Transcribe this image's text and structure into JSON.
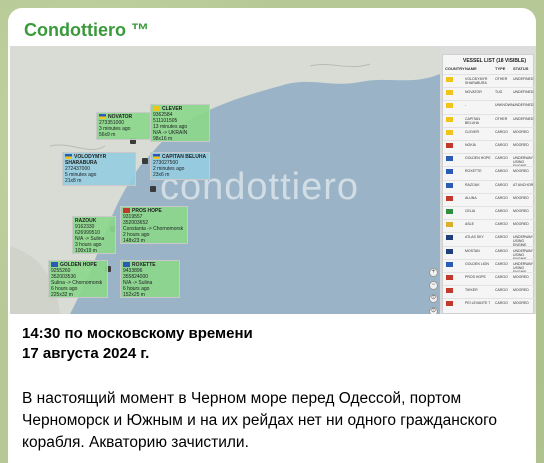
{
  "channel": {
    "name": "Condottiero ™"
  },
  "map": {
    "watermark": "condottiero",
    "vessel_labels": [
      {
        "name": "NOVATOR",
        "lines": [
          "273351000",
          "3 minutes ago",
          "56x9 m"
        ],
        "color": "green"
      },
      {
        "name": "CLEVER",
        "lines": [
          "9362584",
          "511101505",
          "13 minutes ago",
          "N/A -> UKRAIN",
          "98x16 m"
        ],
        "color": "green"
      },
      {
        "name": "VOLODYMYR SHARABURA",
        "lines": [
          "272437000",
          "5 minutes ago",
          "21x8 m"
        ],
        "color": "blue"
      },
      {
        "name": "CAPITAN BELUHA",
        "lines": [
          "273027500",
          "2 minutes ago",
          "23x6 m"
        ],
        "color": "blue"
      },
      {
        "name": "PROS HOPE",
        "lines": [
          "9319557",
          "352003652",
          "Constanta -> Chornomorsk",
          "2 hours ago",
          "148x23 m"
        ],
        "color": "green"
      },
      {
        "name": "RAZOUK",
        "lines": [
          "9162330",
          "626999510",
          "N/A -> Sulina",
          "3 hours ago",
          "100x19 m"
        ],
        "color": "green"
      },
      {
        "name": "GOLDEN HOPE",
        "lines": [
          "9255260",
          "352003536",
          "Sulina -> Chornomorsk",
          "6 hours ago",
          "225x32 m"
        ],
        "color": "green"
      },
      {
        "name": "ROXETTE",
        "lines": [
          "9433896",
          "355824000",
          "N/A -> Sulina",
          "6 hours ago",
          "152x25 m"
        ],
        "color": "green"
      }
    ],
    "zoom_buttons": [
      "+",
      "−",
      "⊙",
      "⊙"
    ]
  },
  "vessel_list": {
    "title": "VESSEL LIST (18 VISIBLE)",
    "headers": [
      "COUNTRY",
      "NAME",
      "TYPE",
      "STATUS"
    ],
    "rows": [
      {
        "name": "VOLODYMYR SHARABURA",
        "type": "OTHER",
        "status": "UNDEFINED",
        "flag": "#f0c419"
      },
      {
        "name": "NOVATOR",
        "type": "TUG",
        "status": "UNDEFINED",
        "flag": "#f0c419"
      },
      {
        "name": "-",
        "type": "UNKNOWN",
        "status": "UNDEFINED",
        "flag": "#f0c419"
      },
      {
        "name": "CAPITAN BELUHA",
        "type": "OTHER",
        "status": "UNDEFINED",
        "flag": "#f0c419"
      },
      {
        "name": "CLEVER",
        "type": "CARGO",
        "status": "MOORED",
        "flag": "#f0c419"
      },
      {
        "name": "NOKIA",
        "type": "CARGO",
        "status": "MOORED",
        "flag": "#c0392b"
      },
      {
        "name": "GOLDEN HOPE",
        "type": "CARGO",
        "status": "UNDERWAY USING ENGINE",
        "flag": "#2b5bb5"
      },
      {
        "name": "ROXETTE",
        "type": "CARGO",
        "status": "MOORED",
        "flag": "#2b5bb5"
      },
      {
        "name": "RAZOUK",
        "type": "CARGO",
        "status": "AT ANCHOR",
        "flag": "#2b5bb5"
      },
      {
        "name": "ALUNA",
        "type": "CARGO",
        "status": "MOORED",
        "flag": "#c0392b"
      },
      {
        "name": "CELIA",
        "type": "CARGO",
        "status": "MOORED",
        "flag": "#2f8f3f"
      },
      {
        "name": "ASLE",
        "type": "CARGO",
        "status": "MOORED",
        "flag": "#d8b02c"
      },
      {
        "name": "ATLAS SKY",
        "type": "CARGO",
        "status": "UNDERWAY USING ENGINE",
        "flag": "#1f3f7a"
      },
      {
        "name": "MOSTAN",
        "type": "CARGO",
        "status": "UNDERWAY USING ENGINE",
        "flag": "#1f3f7a"
      },
      {
        "name": "GOLDEN LION",
        "type": "CARGO",
        "status": "UNDERWAY USING ENGINE",
        "flag": "#2b5bb5"
      },
      {
        "name": "PROS HOPE",
        "type": "CARGO",
        "status": "MOORED",
        "flag": "#c0392b"
      },
      {
        "name": "TIKKER",
        "type": "CARGO",
        "status": "MOORED",
        "flag": "#c0392b"
      },
      {
        "name": "PEI LEVANTE 7",
        "type": "CARGO",
        "status": "MOORED",
        "flag": "#c0392b"
      }
    ]
  },
  "post": {
    "time_line": "14:30 по московскому времени",
    "date_line": "17 августа 2024 г.",
    "body": "В настоящий момент в Черном море перед Одессой, портом Черноморск и Южным и на их рейдах нет ни одного гражданского корабля. Акваторию зачистили."
  },
  "colors": {
    "channel_name": "#3a9a3a",
    "background": "#b5c895",
    "map_sea": "#9ab3c6"
  }
}
